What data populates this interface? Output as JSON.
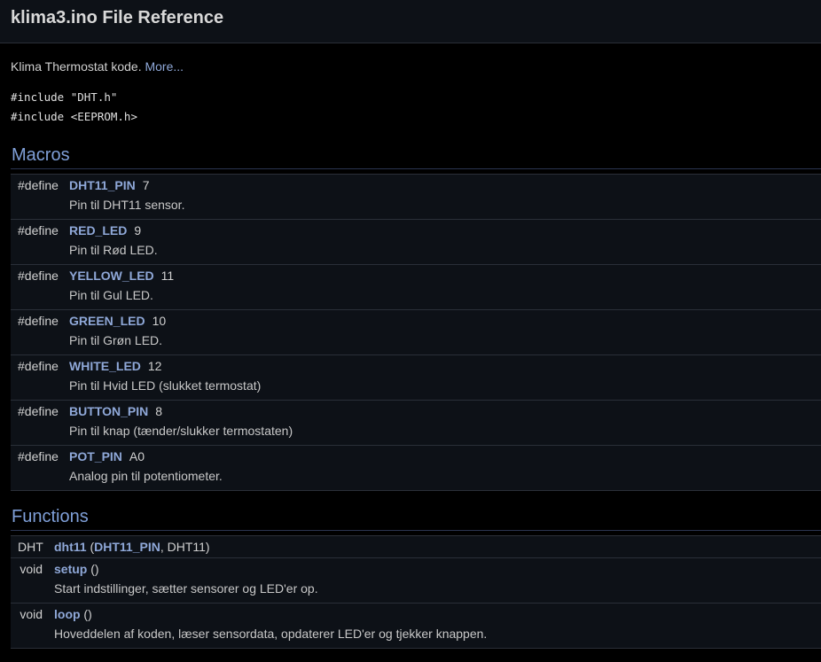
{
  "header": {
    "title": "klima3.ino File Reference"
  },
  "brief": {
    "text": "Klima Thermostat kode.",
    "more_link": "More..."
  },
  "includes": [
    "#include \"DHT.h\"",
    "#include <EEPROM.h>"
  ],
  "macros": {
    "title": "Macros",
    "items": [
      {
        "keyword": "#define",
        "name": "DHT11_PIN",
        "value": "7",
        "desc": "Pin til DHT11 sensor."
      },
      {
        "keyword": "#define",
        "name": "RED_LED",
        "value": "9",
        "desc": "Pin til Rød LED."
      },
      {
        "keyword": "#define",
        "name": "YELLOW_LED",
        "value": "11",
        "desc": "Pin til Gul LED."
      },
      {
        "keyword": "#define",
        "name": "GREEN_LED",
        "value": "10",
        "desc": "Pin til Grøn LED."
      },
      {
        "keyword": "#define",
        "name": "WHITE_LED",
        "value": "12",
        "desc": "Pin til Hvid LED (slukket termostat)"
      },
      {
        "keyword": "#define",
        "name": "BUTTON_PIN",
        "value": "8",
        "desc": "Pin til knap (tænder/slukker termostaten)"
      },
      {
        "keyword": "#define",
        "name": "POT_PIN",
        "value": "A0",
        "desc": "Analog pin til potentiometer."
      }
    ]
  },
  "functions": {
    "title": "Functions",
    "dht": {
      "type": "DHT",
      "name": "dht11",
      "open": " (",
      "arg1": "DHT11_PIN",
      "rest": ", DHT11)"
    },
    "items": [
      {
        "type": "void",
        "name": "setup",
        "args": " ()",
        "desc": "Start indstillinger, sætter sensorer og LED'er op."
      },
      {
        "type": "void",
        "name": "loop",
        "args": " ()",
        "desc": "Hoveddelen af koden, læser sensordata, opdaterer LED'er og tjekker knappen."
      }
    ]
  }
}
